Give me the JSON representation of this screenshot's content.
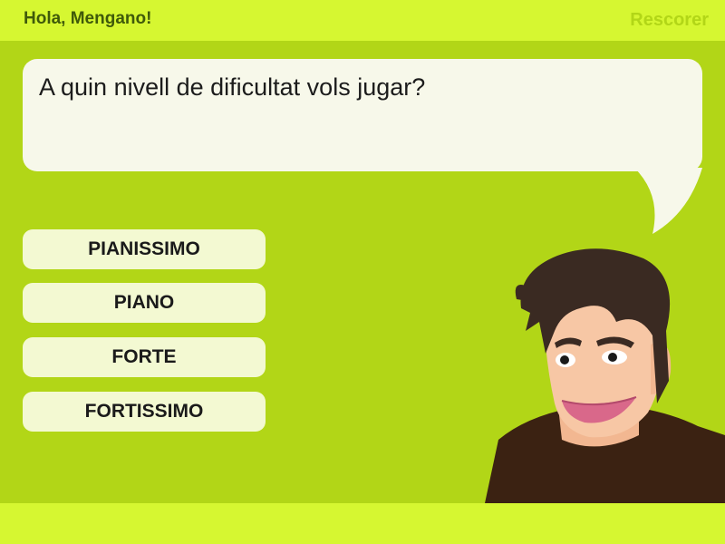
{
  "header": {
    "greeting": "Hola, Mengano!",
    "rescore_label": "Rescorer"
  },
  "question": {
    "text": "A quin nivell de dificultat vols jugar?"
  },
  "options": [
    {
      "label": "PIANISSIMO"
    },
    {
      "label": "PIANO"
    },
    {
      "label": "FORTE"
    },
    {
      "label": "FORTISSIMO"
    }
  ],
  "colors": {
    "background": "#b2d617",
    "bar": "#d6f731",
    "bubble": "#f7f8ea",
    "option": "#f3f9d2",
    "hair": "#3a2a22",
    "skin": "#f7c7a5",
    "shirt": "#3b2212"
  },
  "icons": {
    "character": "host-character-avatar"
  }
}
